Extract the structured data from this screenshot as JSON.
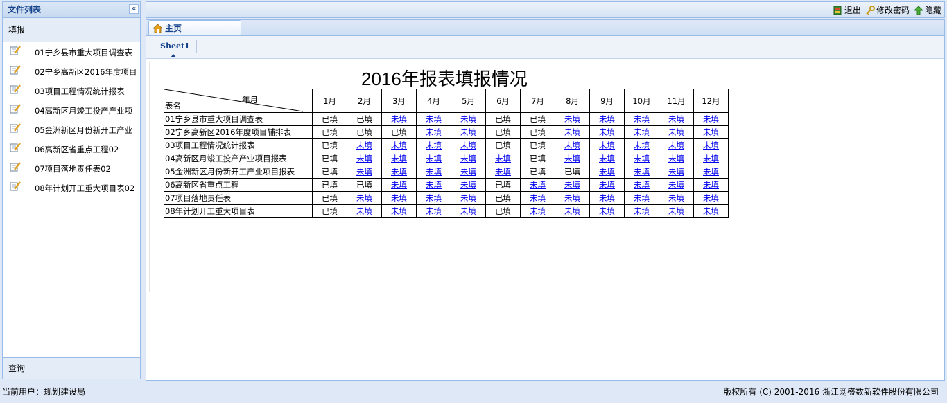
{
  "sidebar": {
    "title": "文件列表",
    "collapse_icon": "«",
    "fill_label": "填报",
    "items": [
      {
        "label": "01宁乡县市重大项目调查表"
      },
      {
        "label": "02宁乡高新区2016年度项目"
      },
      {
        "label": "03项目工程情况统计报表"
      },
      {
        "label": "04高新区月竣工投产产业项"
      },
      {
        "label": "05金洲新区月份新开工产业"
      },
      {
        "label": "06高新区省重点工程02"
      },
      {
        "label": "07项目落地责任表02"
      },
      {
        "label": "08年计划开工重大项目表02"
      }
    ],
    "query_label": "查询"
  },
  "topbar": {
    "logout_label": "退出",
    "change_password_label": "修改密码",
    "hide_label": "隐藏"
  },
  "tabs": {
    "home_label": "主页",
    "sheet_label": "Sheet1"
  },
  "report": {
    "title": "2016年报表填报情况",
    "header_top": "年月",
    "header_bottom": "表名",
    "months": [
      "1月",
      "2月",
      "3月",
      "4月",
      "5月",
      "6月",
      "7月",
      "8月",
      "9月",
      "10月",
      "11月",
      "12月"
    ],
    "filled_text": "已填",
    "pending_text": "未填",
    "rows": [
      {
        "name": "01宁乡县市重大项目调查表",
        "status": [
          "已填",
          "已填",
          "未填",
          "未填",
          "未填",
          "已填",
          "已填",
          "未填",
          "未填",
          "未填",
          "未填",
          "未填"
        ]
      },
      {
        "name": "02宁乡高新区2016年度项目辅排表",
        "status": [
          "已填",
          "已填",
          "已填",
          "未填",
          "未填",
          "已填",
          "已填",
          "未填",
          "未填",
          "未填",
          "未填",
          "未填"
        ]
      },
      {
        "name": "03项目工程情况统计报表",
        "status": [
          "已填",
          "未填",
          "未填",
          "未填",
          "未填",
          "已填",
          "已填",
          "未填",
          "未填",
          "未填",
          "未填",
          "未填"
        ]
      },
      {
        "name": "04高新区月竣工投产产业项目报表",
        "status": [
          "已填",
          "未填",
          "未填",
          "未填",
          "未填",
          "未填",
          "已填",
          "未填",
          "未填",
          "未填",
          "未填",
          "未填"
        ]
      },
      {
        "name": "05金洲新区月份新开工产业项目报表",
        "status": [
          "已填",
          "未填",
          "未填",
          "未填",
          "未填",
          "未填",
          "已填",
          "已填",
          "未填",
          "未填",
          "未填",
          "未填"
        ]
      },
      {
        "name": "06高新区省重点工程",
        "status": [
          "已填",
          "已填",
          "未填",
          "未填",
          "未填",
          "已填",
          "未填",
          "未填",
          "未填",
          "未填",
          "未填",
          "未填"
        ]
      },
      {
        "name": "07项目落地责任表",
        "status": [
          "已填",
          "未填",
          "未填",
          "未填",
          "未填",
          "已填",
          "未填",
          "未填",
          "未填",
          "未填",
          "未填",
          "未填"
        ]
      },
      {
        "name": "08年计划开工重大项目表",
        "status": [
          "已填",
          "未填",
          "未填",
          "未填",
          "未填",
          "已填",
          "未填",
          "未填",
          "未填",
          "未填",
          "未填",
          "未填"
        ]
      }
    ]
  },
  "status": {
    "current_user": "当前用户：规划建设局",
    "copyright": "版权所有 (C) 2001-2016 浙江网盛数新软件股份有限公司"
  },
  "colors": {
    "border": "#99bbe8",
    "title_text": "#15428b",
    "link": "#0000ee"
  }
}
